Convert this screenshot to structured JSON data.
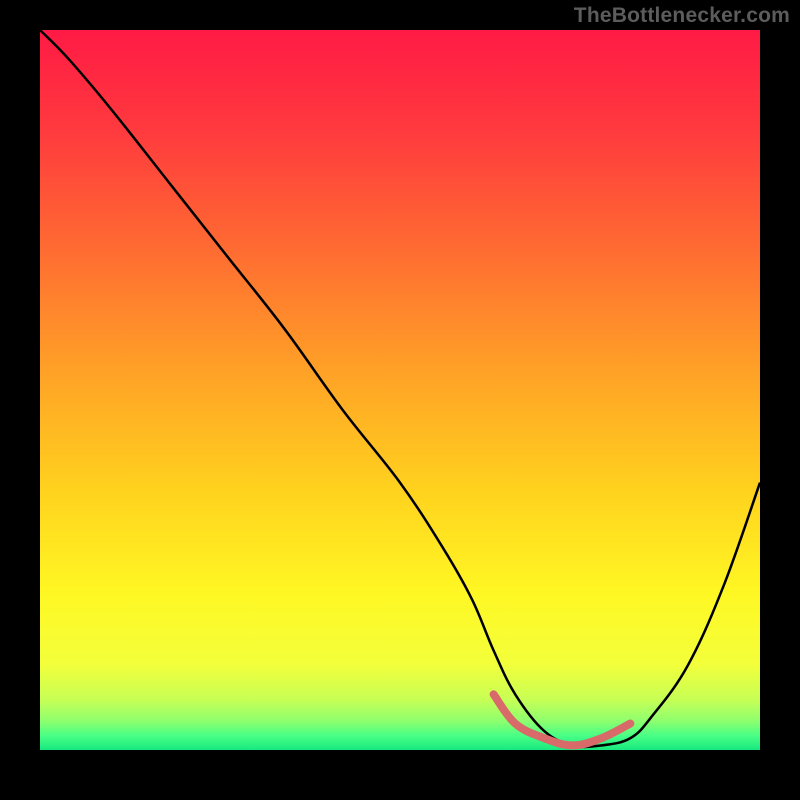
{
  "watermark": "TheBottlenecker.com",
  "gradient_stops": [
    {
      "pct": 0,
      "color": "#ff1a45"
    },
    {
      "pct": 14,
      "color": "#ff3a3e"
    },
    {
      "pct": 30,
      "color": "#ff6a32"
    },
    {
      "pct": 48,
      "color": "#ffa326"
    },
    {
      "pct": 64,
      "color": "#ffd21e"
    },
    {
      "pct": 78,
      "color": "#fff723"
    },
    {
      "pct": 88,
      "color": "#f3ff3a"
    },
    {
      "pct": 93,
      "color": "#c7ff55"
    },
    {
      "pct": 96,
      "color": "#8dff6e"
    },
    {
      "pct": 98,
      "color": "#49ff86"
    },
    {
      "pct": 100,
      "color": "#17e87e"
    }
  ],
  "chart_data": {
    "type": "line",
    "title": "",
    "xlabel": "",
    "ylabel": "",
    "xlim": [
      0,
      100
    ],
    "ylim": [
      0,
      100
    ],
    "series": [
      {
        "name": "bottleneck-curve",
        "x": [
          0,
          4,
          10,
          18,
          26,
          34,
          42,
          50,
          56,
          60,
          63,
          66,
          70,
          74,
          78,
          82,
          85,
          90,
          95,
          100
        ],
        "y": [
          100,
          96,
          89,
          79,
          69,
          59,
          48,
          38,
          29,
          22,
          15,
          9,
          4,
          2,
          2,
          3,
          6,
          13,
          24,
          38
        ]
      },
      {
        "name": "highlight-band",
        "x": [
          63,
          66,
          70,
          74,
          78,
          82
        ],
        "y": [
          9,
          5,
          3,
          2,
          3,
          5
        ]
      }
    ],
    "colors": {
      "bottleneck-curve": "#000000",
      "highlight-band": "#d86a6a"
    }
  }
}
